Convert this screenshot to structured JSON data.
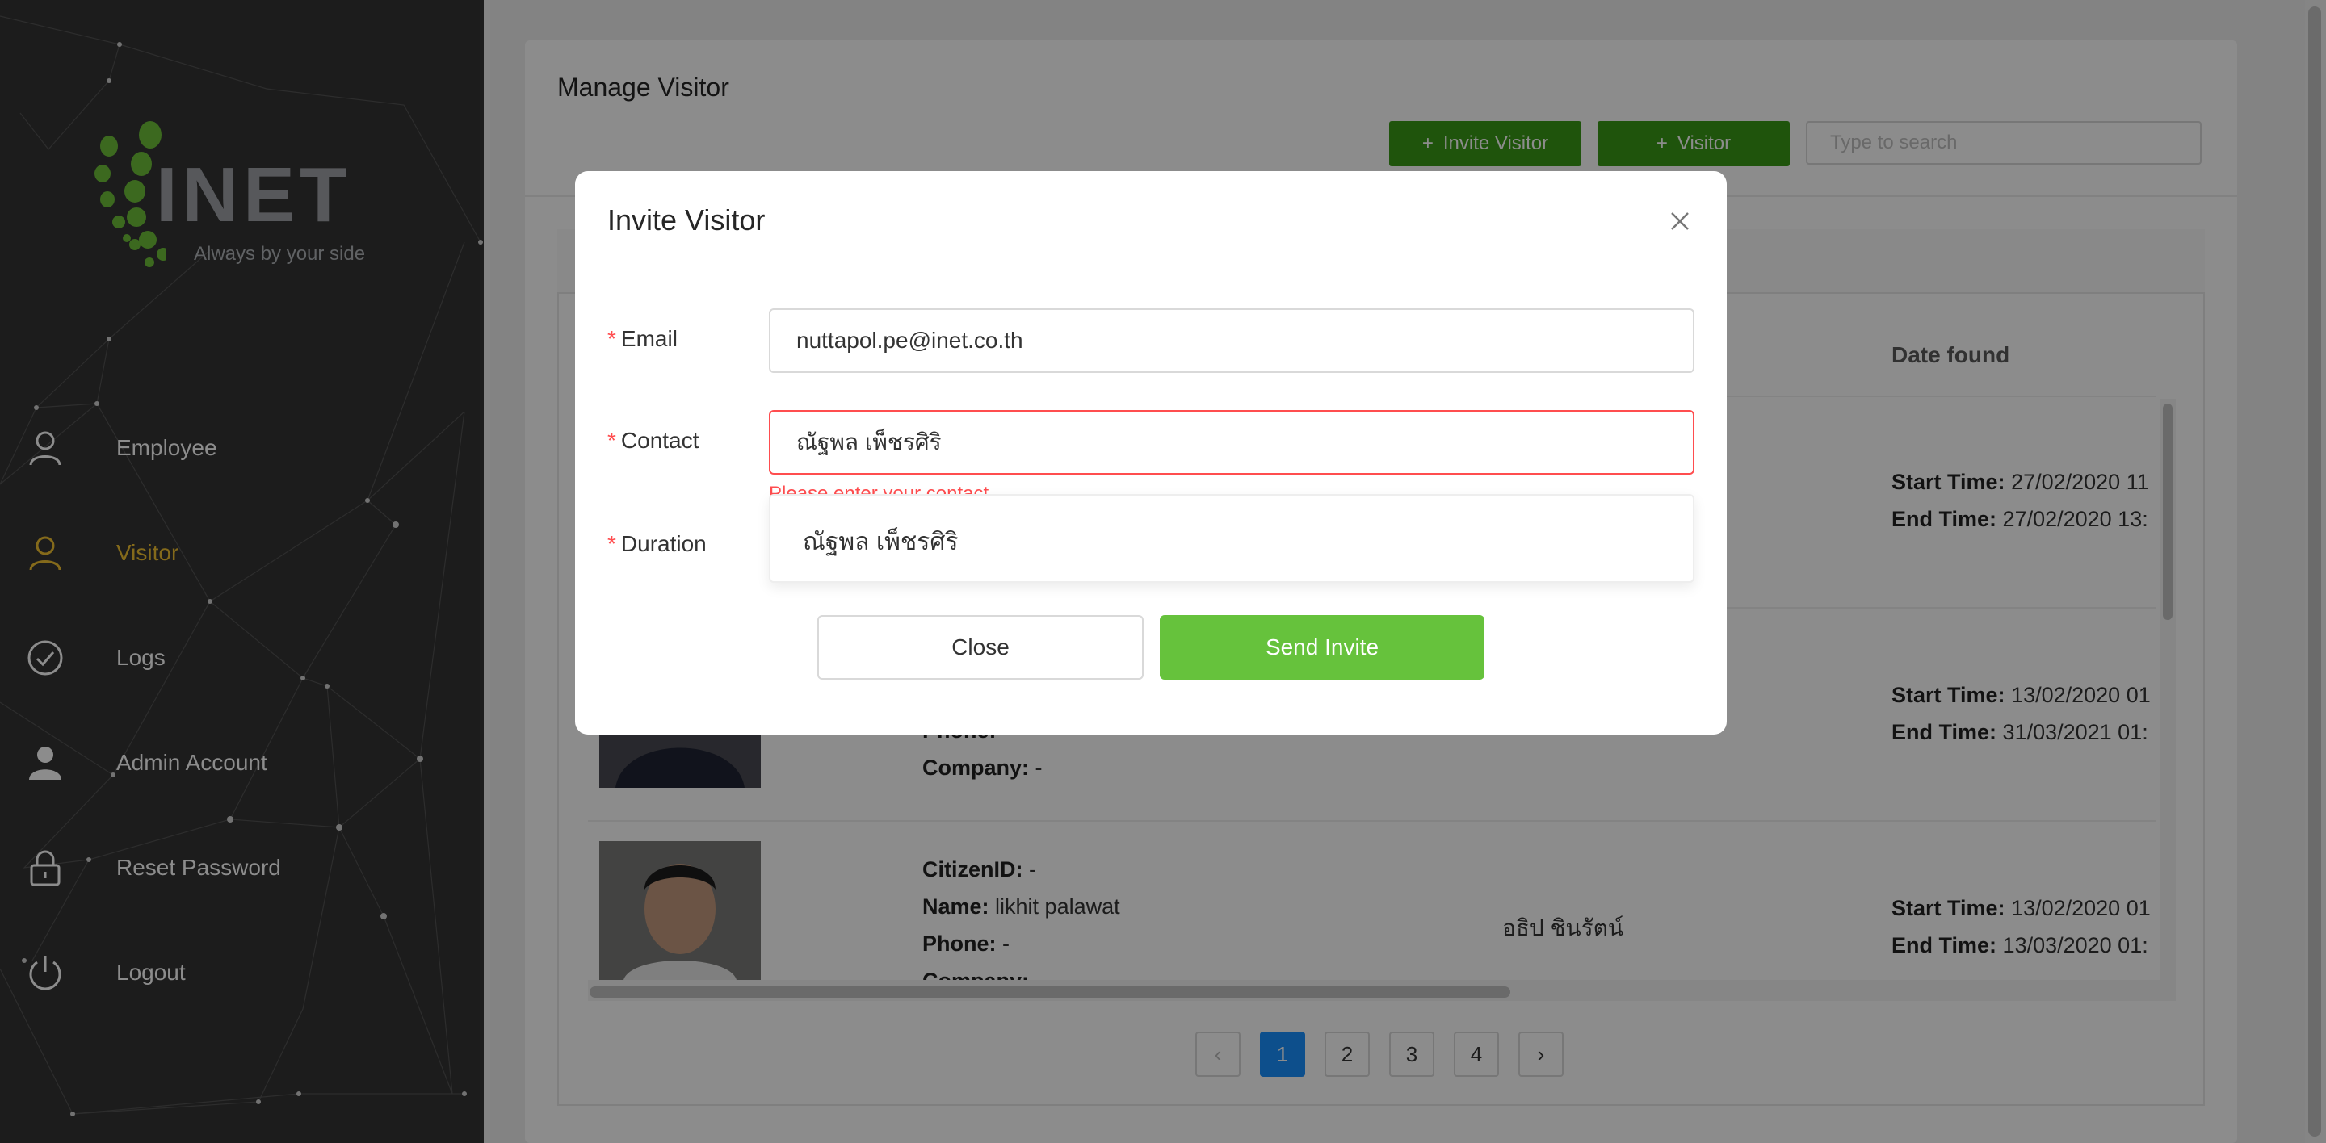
{
  "brand": {
    "name": "INET",
    "tagline": "Always by your side",
    "accent_color": "#6dbf3a"
  },
  "sidebar": {
    "items": [
      {
        "label": "Employee",
        "icon": "user-outline-icon",
        "active": false
      },
      {
        "label": "Visitor",
        "icon": "user-outline-icon",
        "active": true
      },
      {
        "label": "Logs",
        "icon": "check-circle-icon",
        "active": false
      },
      {
        "label": "Admin Account",
        "icon": "user-filled-icon",
        "active": false
      },
      {
        "label": "Reset Password",
        "icon": "lock-icon",
        "active": false
      },
      {
        "label": "Logout",
        "icon": "power-icon",
        "active": false
      }
    ],
    "active_color": "#f1c232"
  },
  "page": {
    "title": "Manage Visitor",
    "invite_button": "Invite Visitor",
    "visitor_button": "Visitor",
    "search_placeholder": "Type to search"
  },
  "table": {
    "column_date_found": "Date found",
    "rows": [
      {
        "start_label": "Start Time:",
        "start_value": "27/02/2020 11",
        "end_label": "End Time:",
        "end_value": "27/02/2020 13:"
      },
      {
        "phone_label": "Phone:",
        "company_label": "Company:",
        "company_value": "-",
        "start_label": "Start Time:",
        "start_value": "13/02/2020 01",
        "end_label": "End Time:",
        "end_value": "31/03/2021 01:"
      },
      {
        "citizen_label": "CitizenID:",
        "citizen_value": "-",
        "name_label": "Name:",
        "name_value": "likhit palawat",
        "phone_label": "Phone:",
        "phone_value": "-",
        "company_label": "Company:",
        "found_by": "อธิป ชินรัตน์",
        "start_label": "Start Time:",
        "start_value": "13/02/2020 01",
        "end_label": "End Time:",
        "end_value": "13/03/2020 01:"
      }
    ]
  },
  "pagination": {
    "pages": [
      "1",
      "2",
      "3",
      "4"
    ],
    "current": "1",
    "prev": "‹",
    "next": "›"
  },
  "modal": {
    "title": "Invite Visitor",
    "close_icon": "×",
    "email_label": "Email",
    "email_value": "nuttapol.pe@inet.co.th",
    "contact_label": "Contact",
    "contact_value": "ณัฐพล เพ็ชรศิริ",
    "contact_error": "Please enter your contact",
    "duration_label": "Duration",
    "dropdown_option": "ณัฐพล เพ็ชรศิริ",
    "close_button": "Close",
    "send_button": "Send Invite",
    "required_mark": "*"
  }
}
